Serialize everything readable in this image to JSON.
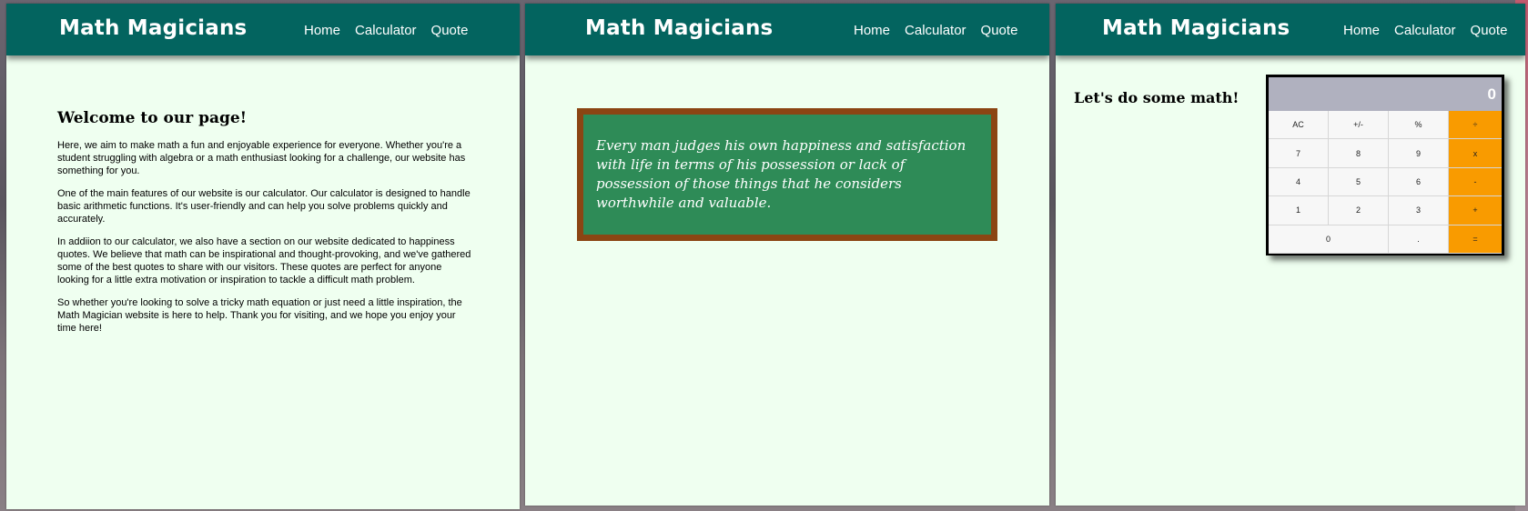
{
  "brand": "Math Magicians",
  "nav": [
    "Home",
    "Calculator",
    "Quote"
  ],
  "home": {
    "heading": "Welcome to our page!",
    "paragraphs": [
      "Here, we aim to make math a fun and enjoyable experience for everyone. Whether you're a student struggling with algebra or a math enthusiast looking for a challenge, our website has something for you.",
      "One of the main features of our website is our calculator. Our calculator is designed to handle basic arithmetic functions. It's user-friendly and can help you solve problems quickly and accurately.",
      "In addiion to our calculator, we also have a section on our website dedicated to happiness quotes. We believe that math can be inspirational and thought-provoking, and we've gathered some of the best quotes to share with our visitors. These quotes are perfect for anyone looking for a little extra motivation or inspiration to tackle a difficult math problem.",
      "So whether you're looking to solve a tricky math equation or just need a little inspiration, the Math Magician website is here to help. Thank you for visiting, and we hope you enjoy your time here!"
    ]
  },
  "quote": {
    "text": "Every man judges his own happiness and satisfaction with life in terms of his possession or lack of possession of those things that he considers worthwhile and valuable."
  },
  "calculator": {
    "heading": "Let's do some math!",
    "display": "0",
    "keys": {
      "ac": "AC",
      "sign": "+/-",
      "percent": "%",
      "divide": "÷",
      "seven": "7",
      "eight": "8",
      "nine": "9",
      "multiply": "x",
      "four": "4",
      "five": "5",
      "six": "6",
      "minus": "-",
      "one": "1",
      "two": "2",
      "three": "3",
      "plus": "+",
      "zero": "0",
      "dot": ".",
      "equals": "="
    }
  },
  "colors": {
    "navbar": "#03645f",
    "page_bg": "#effff0",
    "board": "#2e8b57",
    "board_frame": "#8b4513",
    "operator": "#f99b00",
    "display": "#b0b1bf"
  }
}
